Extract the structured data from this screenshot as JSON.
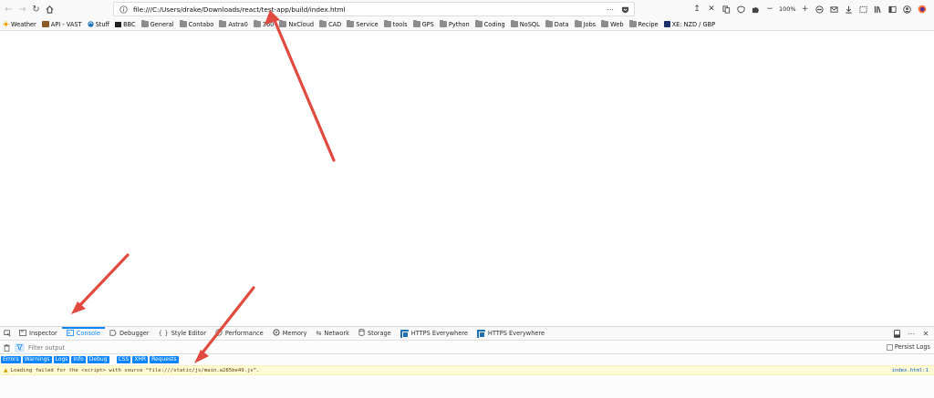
{
  "toolbar": {
    "back_icon": "back-arrow-icon",
    "forward_icon": "forward-arrow-icon",
    "reload_icon": "reload-icon",
    "home_icon": "home-icon",
    "url": "file:///C:/Users/drake/Downloads/react/test-app/build/index.html",
    "zoom": "100%"
  },
  "bookmarks": [
    {
      "label": "Weather",
      "icon": "weather-icon"
    },
    {
      "label": "API - VAST",
      "icon": "api-icon"
    },
    {
      "label": "Stuff",
      "icon": "stuff-icon"
    },
    {
      "label": "BBC",
      "icon": "bbc-icon"
    },
    {
      "label": "General",
      "icon": "folder-icon"
    },
    {
      "label": "Contabo",
      "icon": "folder-icon"
    },
    {
      "label": "Astra0",
      "icon": "folder-icon"
    },
    {
      "label": "360",
      "icon": "folder-icon"
    },
    {
      "label": "NxCloud",
      "icon": "folder-icon"
    },
    {
      "label": "CAD",
      "icon": "folder-icon"
    },
    {
      "label": "Service",
      "icon": "folder-icon"
    },
    {
      "label": "tools",
      "icon": "folder-icon"
    },
    {
      "label": "GPS",
      "icon": "folder-icon"
    },
    {
      "label": "Python",
      "icon": "folder-icon"
    },
    {
      "label": "Coding",
      "icon": "folder-icon"
    },
    {
      "label": "NoSQL",
      "icon": "folder-icon"
    },
    {
      "label": "Data",
      "icon": "folder-icon"
    },
    {
      "label": "Jobs",
      "icon": "folder-icon"
    },
    {
      "label": "Web",
      "icon": "folder-icon"
    },
    {
      "label": "Recipe",
      "icon": "folder-icon"
    },
    {
      "label": "XE: NZD / GBP",
      "icon": "xe-icon"
    }
  ],
  "devtools": {
    "tabs": [
      {
        "label": "Inspector",
        "icon": "inspector-icon"
      },
      {
        "label": "Console",
        "icon": "console-icon"
      },
      {
        "label": "Debugger",
        "icon": "debugger-icon"
      },
      {
        "label": "Style Editor",
        "icon": "style-editor-icon"
      },
      {
        "label": "Performance",
        "icon": "performance-icon"
      },
      {
        "label": "Memory",
        "icon": "memory-icon"
      },
      {
        "label": "Network",
        "icon": "network-icon"
      },
      {
        "label": "Storage",
        "icon": "storage-icon"
      },
      {
        "label": "HTTPS Everywhere",
        "icon": "https-everywhere-icon"
      },
      {
        "label": "HTTPS Everywhere",
        "icon": "https-everywhere-icon"
      }
    ],
    "active_tab": "Console",
    "filter_placeholder": "Filter output",
    "persist_logs": "Persist Logs",
    "categories": [
      "Errors",
      "Warnings",
      "Logs",
      "Info",
      "Debug",
      "CSS",
      "XHR",
      "Requests"
    ],
    "message": {
      "text": "Loading failed for the <script> with source “file:///static/js/main.a285be49.js”.",
      "location": "index.html:1"
    }
  },
  "colors": {
    "accent": "#0a84ff",
    "warning_bg": "#fffbd6",
    "annotation_arrow": "#e04a3f"
  }
}
